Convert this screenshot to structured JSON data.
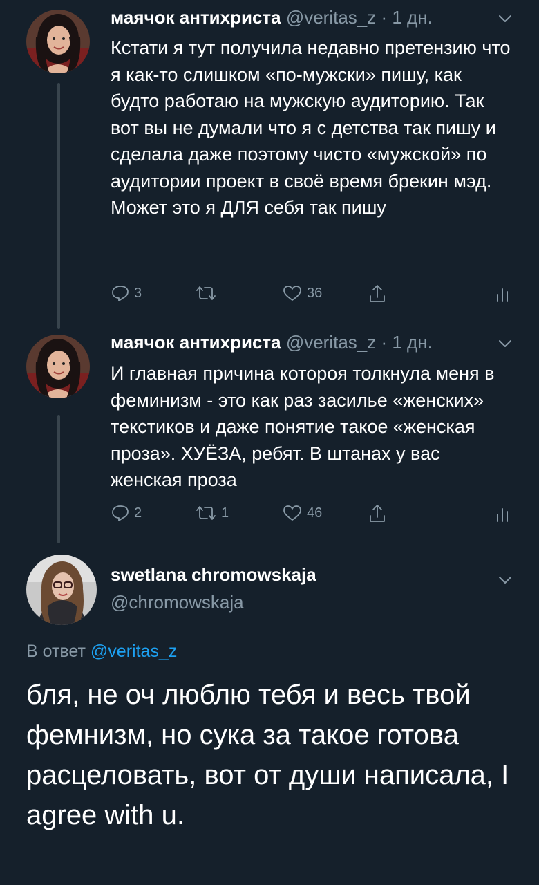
{
  "tweets": [
    {
      "author_name": "маячок антихриста",
      "author_handle": "@veritas_z · 1 дн.",
      "text": "Кстати я тут получила недавно претензию что я как-то слишком «по-мужски» пишу, как будто работаю на мужскую аудиторию. Так вот вы не думали что я с детства так пишу и сделала даже поэтому чисто «мужской» по аудитории проект в своё время брекин мэд. Может это я ДЛЯ себя так пишу",
      "replies": "3",
      "retweets": "",
      "likes": "36",
      "avatar_icon": "avatar-woman-dark-hair"
    },
    {
      "author_name": "маячок антихриста",
      "author_handle": "@veritas_z · 1 дн.",
      "text": "И главная причина котороя толкнула меня в феминизм - это как раз засилье «женских» текстиков и даже понятие такое «женская проза». ХУЁЗА, ребят. В штанах у вас женская проза",
      "replies": "2",
      "retweets": "1",
      "likes": "46",
      "avatar_icon": "avatar-woman-dark-hair"
    }
  ],
  "main_tweet": {
    "author_name": "swetlana chromowskaja",
    "author_handle": "@chromowskaja",
    "reply_prefix": "В ответ",
    "reply_to": "@veritas_z",
    "text": "бля, не оч люблю тебя и весь твой фемнизм, но сука за такое готова расцеловать, вот от души написала, I agree with u.",
    "avatar_icon": "avatar-woman-glasses"
  },
  "colors": {
    "background": "#15202b",
    "secondary_text": "#8899a6",
    "link": "#1da1f2",
    "thread_line": "#38444d"
  },
  "icons": [
    "reply-icon",
    "retweet-icon",
    "like-icon",
    "share-icon",
    "analytics-icon",
    "chevron-down-icon"
  ]
}
